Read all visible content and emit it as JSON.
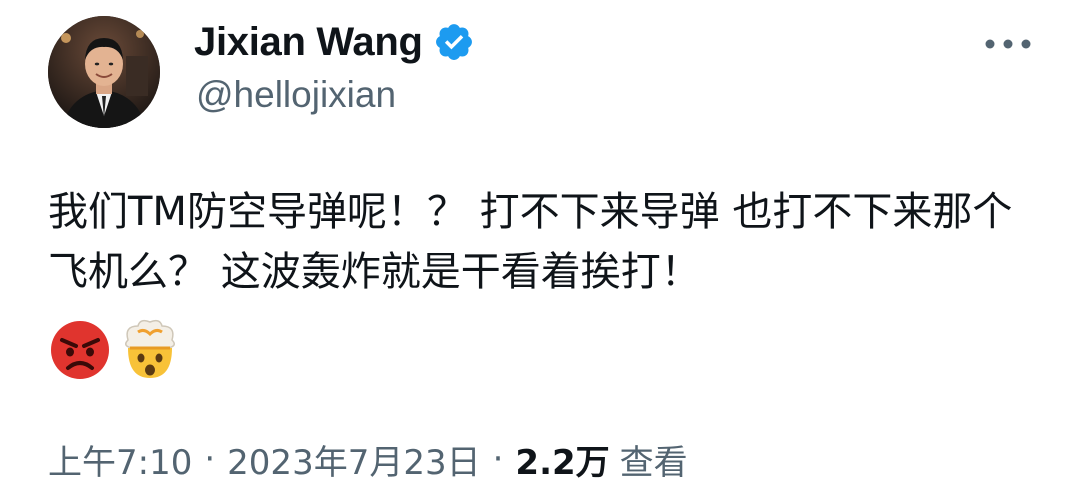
{
  "author": {
    "display_name": "Jixian Wang",
    "handle": "@hellojixian",
    "verified": true
  },
  "tweet": {
    "text": "我们TM防空导弹呢！？ 打不下来导弹 也打不下来那个飞机么？ 这波轰炸就是干看着挨打！",
    "emojis": [
      "pouting-face-emoji",
      "exploding-head-emoji"
    ]
  },
  "meta": {
    "time": "上午7:10",
    "separator": "·",
    "date": "2023年7月23日",
    "views_count": "2.2万",
    "views_label": "查看"
  },
  "colors": {
    "verified_blue": "#1d9bf0",
    "secondary_text": "#536471",
    "primary_text": "#0f1419"
  },
  "icons": {
    "more": "more-horizontal-icon",
    "verified": "verified-badge-icon"
  }
}
